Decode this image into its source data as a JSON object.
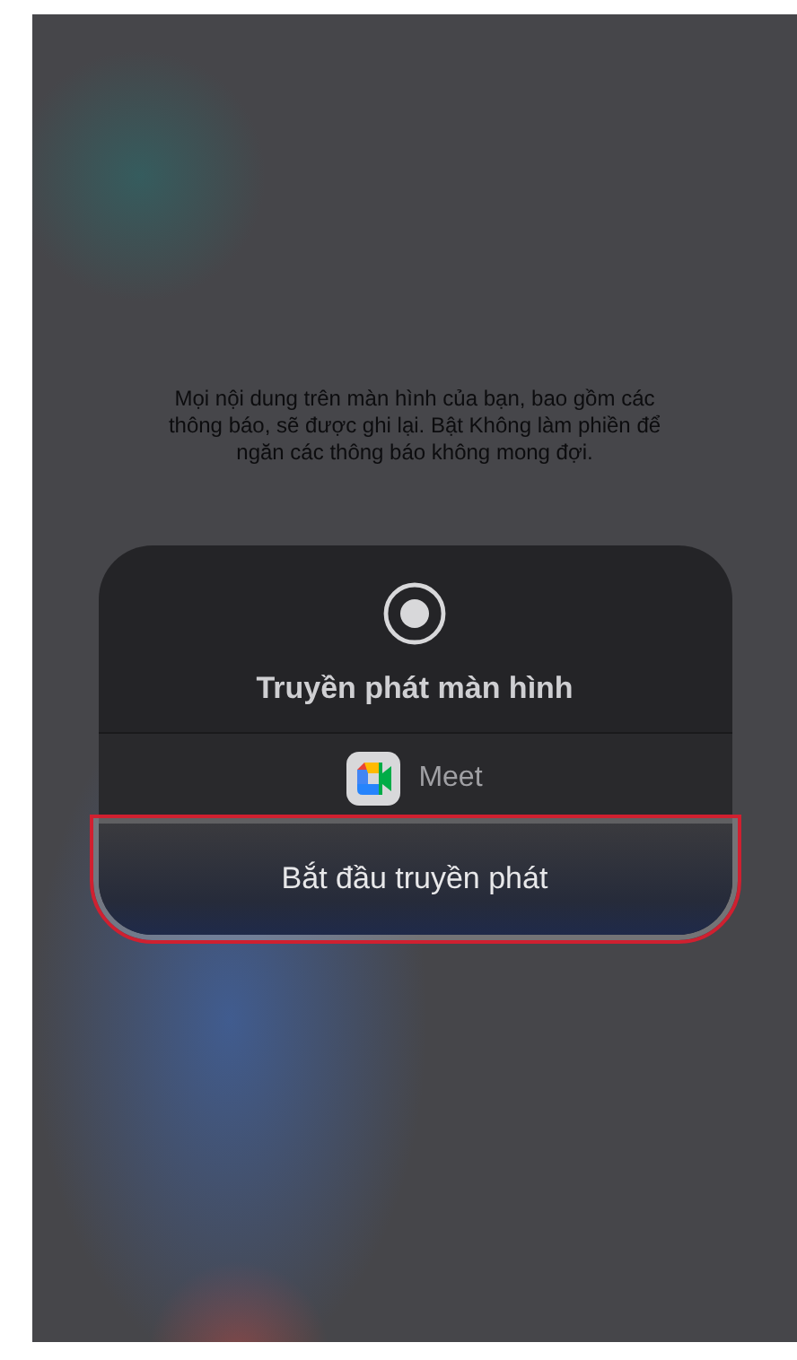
{
  "notice": "Mọi nội dung trên màn hình của bạn, bao gồm các thông báo, sẽ được ghi lại. Bật Không làm phiền để ngăn các thông báo không mong đợi.",
  "sheet": {
    "title": "Truyền phát màn hình",
    "app": {
      "name": "Meet"
    },
    "start_button": {
      "label": "Bắt đầu truyền phát",
      "highlighted": true
    }
  }
}
